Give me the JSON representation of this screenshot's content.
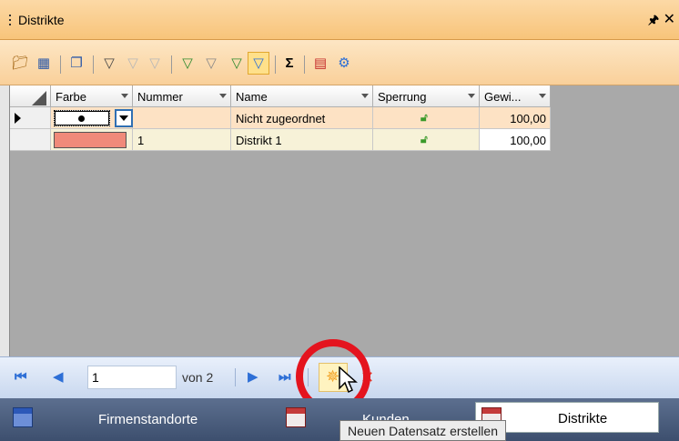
{
  "window": {
    "title": "Distrikte",
    "pin_glyph": "◊",
    "close_glyph": "✕"
  },
  "toolbar": {
    "icons": [
      "properties-icon",
      "layout-icon",
      "copy-icon",
      "filter-icon",
      "filter-remove-icon",
      "filter-clear-icon",
      "filter-funnel-icon",
      "filter-add-icon",
      "filter-edit-icon",
      "filter-active-icon",
      "sum-icon",
      "export-icon",
      "search-settings-icon"
    ],
    "sum_glyph": "Σ"
  },
  "grid": {
    "columns": [
      "Farbe",
      "Nummer",
      "Name",
      "Sperrung",
      "Gewi..."
    ],
    "rows": [
      {
        "farbe": "",
        "nummer": "",
        "name": "Nicht zugeordnet",
        "sperrung_icon": "lock-open-icon",
        "gewicht": "100,00",
        "current": true
      },
      {
        "farbe": "#f08a7a",
        "nummer": "1",
        "name": "Distrikt 1",
        "sperrung_icon": "lock-open-icon",
        "gewicht": "100,00",
        "current": false
      }
    ],
    "colors": {
      "row_current": "#fde2c4",
      "row_alt": "#f7f2d8",
      "header_bg": "#f2f2f2",
      "empty_area": "#a9a9a9"
    }
  },
  "navigator": {
    "position": "1",
    "of_label": "von 2",
    "tooltip": "Neuen Datensatz erstellen"
  },
  "tabs": [
    {
      "label": "Firmenstandorte",
      "active": false
    },
    {
      "label": "Kunden",
      "active": false
    },
    {
      "label": "Distrikte",
      "active": true
    }
  ],
  "colors": {
    "titlebar": "#f8c47a",
    "accent_blue": "#2e6fd6",
    "highlight_ring": "#e4141e",
    "tab_bar": "#4a5b7a"
  }
}
